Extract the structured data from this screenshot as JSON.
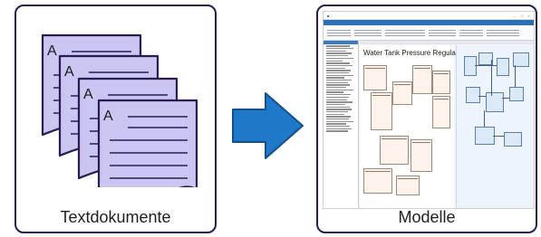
{
  "left_panel": {
    "caption": "Textdokumente",
    "document_letter": "A",
    "document_count": 4
  },
  "right_panel": {
    "caption": "Modelle",
    "screenshot": {
      "diagram_title": "Water Tank Pressure Regulator"
    }
  },
  "colors": {
    "panel_border": "#2b1b4f",
    "document_fill": "#c9c6f2",
    "document_stroke": "#2b1b4f",
    "arrow_fill": "#1f78c8",
    "arrow_stroke": "#154f8a"
  },
  "icons": [
    "document-stack-icon",
    "right-arrow-icon",
    "modeling-tool-screenshot"
  ]
}
